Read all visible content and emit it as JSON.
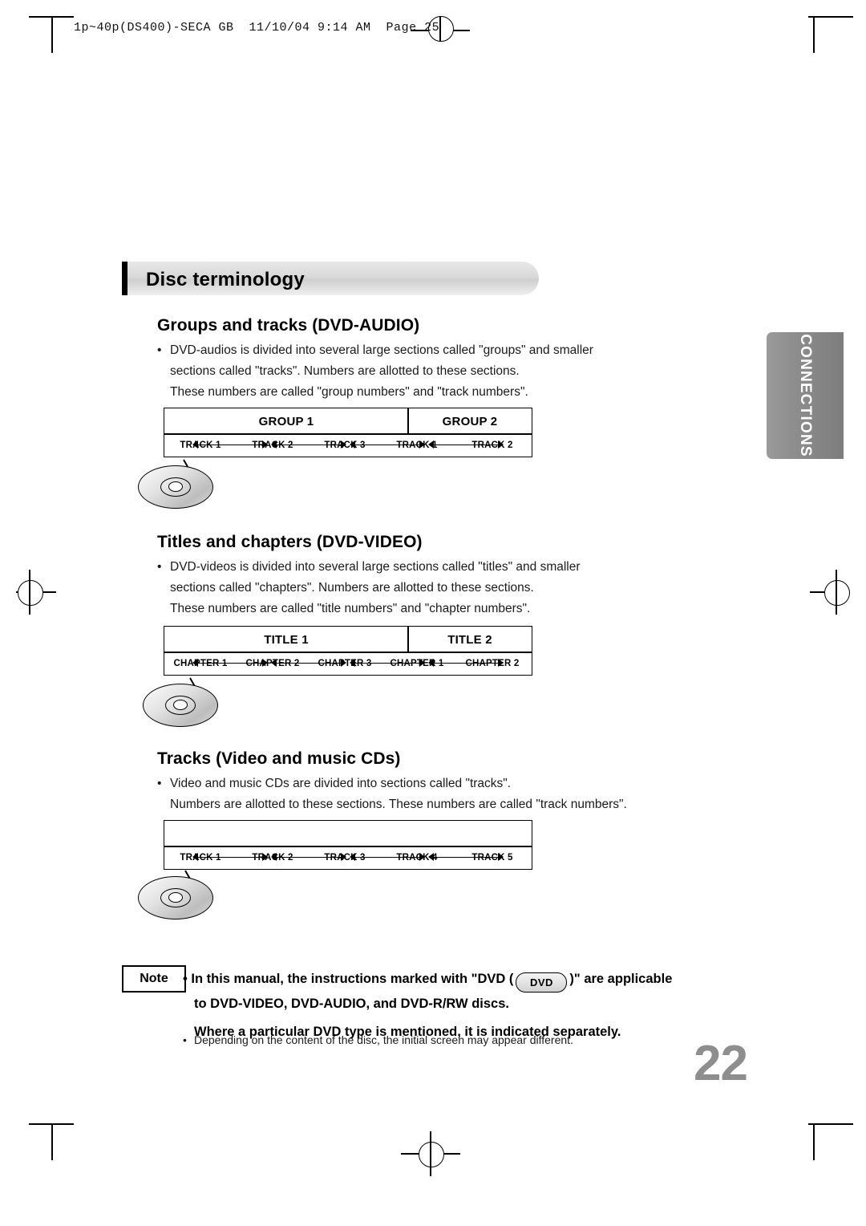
{
  "print_header": "1p~40p(DS400)-SECA GB  11/10/04 9:14 AM  Page 25",
  "title": "Disc terminology",
  "side_tab": "CONNECTIONS",
  "page_number": "22",
  "sections": [
    {
      "heading": "Groups and tracks (DVD-AUDIO)",
      "bullet": "•",
      "lines": [
        "DVD-audios is divided into several large sections called \"groups\" and smaller",
        "sections called \"tracks\". Numbers are allotted to these sections.",
        "These numbers are called \"group numbers\" and \"track numbers\"."
      ],
      "diagram": {
        "top_row": [
          "GROUP 1",
          "GROUP 2"
        ],
        "bottom_row": [
          "TRACK 1",
          "TRACK 2",
          "TRACK 3",
          "TRACK 1",
          "TRACK 2"
        ]
      }
    },
    {
      "heading": "Titles and chapters (DVD-VIDEO)",
      "bullet": "•",
      "lines": [
        "DVD-videos is divided into several large sections called \"titles\" and smaller",
        "sections called \"chapters\". Numbers are allotted to these sections.",
        "These numbers are called \"title numbers\" and \"chapter numbers\"."
      ],
      "diagram": {
        "top_row": [
          "TITLE 1",
          "TITLE 2"
        ],
        "bottom_row": [
          "CHAPTER 1",
          "CHAPTER 2",
          "CHAPTER 3",
          "CHAPTER 1",
          "CHAPTER 2"
        ]
      }
    },
    {
      "heading": "Tracks (Video and music CDs)",
      "bullet": "•",
      "lines": [
        "Video and music CDs are divided into sections called \"tracks\".",
        "Numbers are allotted to these sections. These numbers are called \"track numbers\"."
      ],
      "diagram": {
        "top_row": [],
        "bottom_row": [
          "TRACK 1",
          "TRACK 2",
          "TRACK 3",
          "TRACK 4",
          "TRACK 5"
        ]
      }
    }
  ],
  "note": {
    "label": "Note",
    "bullet": "•",
    "line1_a": "In this manual, the instructions marked with \"DVD (",
    "pill": "DVD",
    "line1_b": ")\" are applicable",
    "line2": "to DVD-VIDEO, DVD-AUDIO, and DVD-R/RW discs.",
    "line3": "Where a particular DVD type is mentioned, it is indicated separately.",
    "sub_bullet": "•",
    "sub_line": "Depending on the content of the disc, the initial screen may appear different."
  }
}
